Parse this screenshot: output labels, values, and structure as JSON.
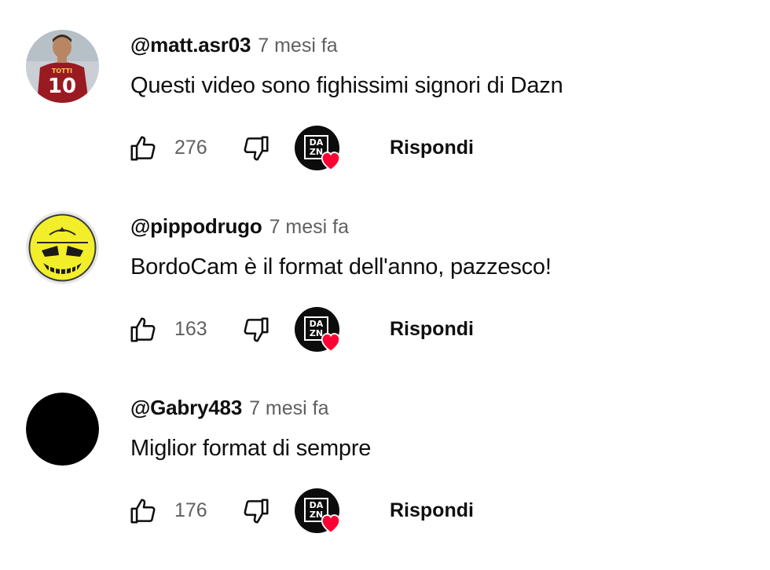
{
  "comments": [
    {
      "author": "@matt.asr03",
      "time": "7 mesi fa",
      "text": "Questi video sono fighissimi signori di Dazn",
      "likes": "276",
      "reply_label": "Rispondi",
      "avatar": "footballer-photo",
      "avatar_shirt_name": "TOTTI",
      "avatar_shirt_number": "10"
    },
    {
      "author": "@pippodrugo",
      "time": "7 mesi fa",
      "text": "BordoCam è il format dell'anno, pazzesco!",
      "likes": "163",
      "reply_label": "Rispondi",
      "avatar": "yellow-skull-face"
    },
    {
      "author": "@Gabry483",
      "time": "7 mesi fa",
      "text": "Miglior format di sempre",
      "likes": "176",
      "reply_label": "Rispondi",
      "avatar": "black-circle"
    }
  ],
  "creator_badge": {
    "line1": "DA",
    "line2": "ZN",
    "heart_color": "#ff0033"
  },
  "icons": {
    "like": "thumbs-up-icon",
    "dislike": "thumbs-down-icon",
    "creator_heart": "creator-heart-icon"
  },
  "colors": {
    "text_primary": "#0f0f0f",
    "text_secondary": "#606060",
    "heart": "#ff0033"
  }
}
